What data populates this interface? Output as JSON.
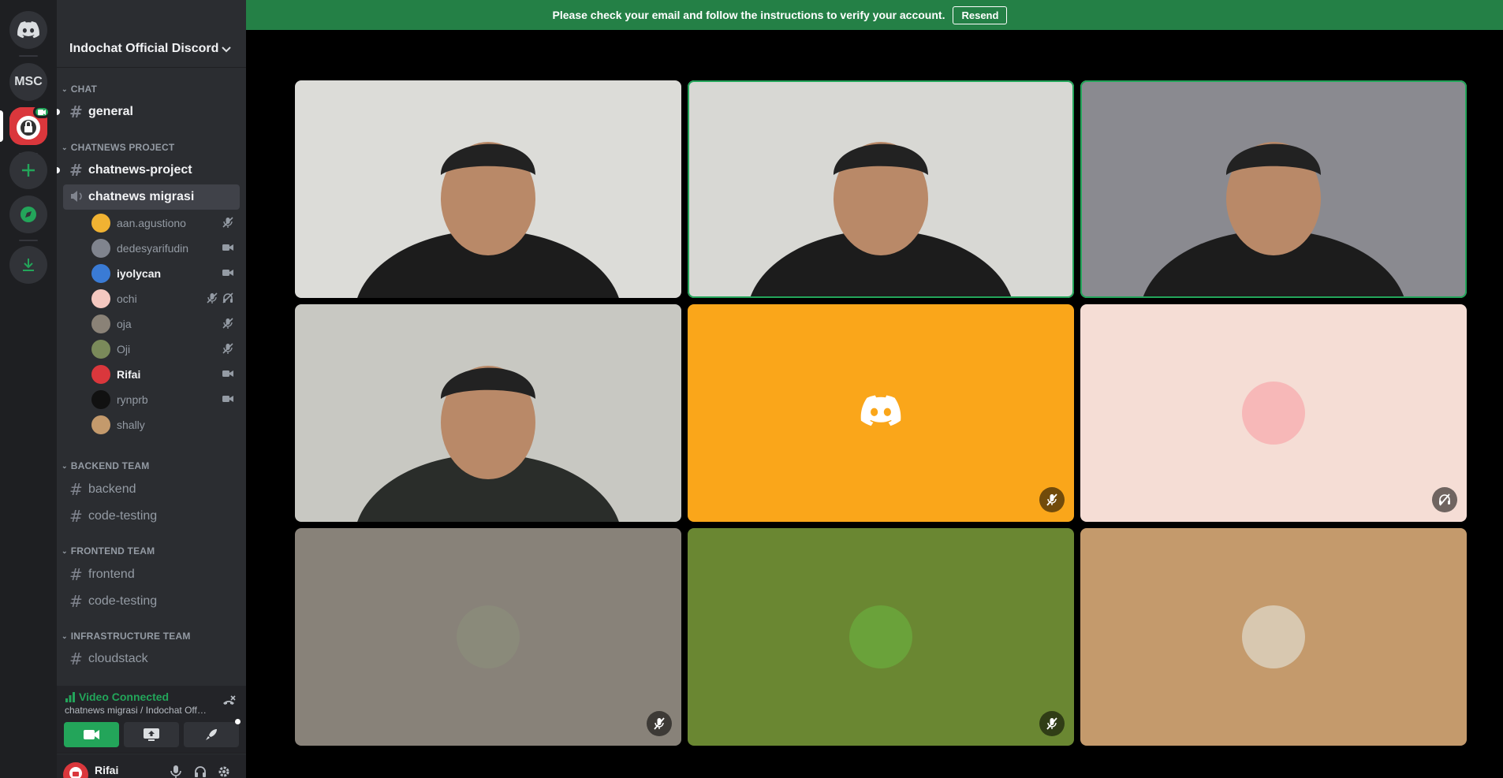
{
  "banner": {
    "message": "Please check your email and follow the instructions to verify your account.",
    "button": "Resend",
    "color": "#248046"
  },
  "rail": {
    "servers": [
      {
        "name": "discord-home-icon"
      },
      {
        "label": "MSC"
      },
      {
        "name": "indochat-server-icon",
        "badge": "video"
      },
      {
        "name": "add-server-icon"
      },
      {
        "name": "explore-icon"
      },
      {
        "name": "download-icon"
      }
    ]
  },
  "server": {
    "name": "Indochat Official Discord"
  },
  "categories": {
    "chat": "CHAT",
    "chatnews_project": "CHATNEWS PROJECT",
    "backend": "BACKEND TEAM",
    "frontend": "FRONTEND TEAM",
    "infrastructure": "INFRASTRUCTURE TEAM"
  },
  "channels": {
    "general": "general",
    "chatnews_project": "chatnews-project",
    "chatnews_migrasi": "chatnews migrasi",
    "backend": "backend",
    "backend_code_testing": "code-testing",
    "frontend": "frontend",
    "frontend_code_testing": "code-testing",
    "cloudstack": "cloudstack"
  },
  "voice_users": [
    {
      "name": "aan.agustiono",
      "icons": [
        "muted-icon"
      ],
      "avatar_color": "#f0b232"
    },
    {
      "name": "dedesyarifudin",
      "icons": [
        "camera-icon"
      ],
      "avatar_color": "#80848e"
    },
    {
      "name": "iyolycan",
      "icons": [
        "camera-icon"
      ],
      "avatar_color": "#3a7bd5",
      "bright": true
    },
    {
      "name": "ochi",
      "icons": [
        "muted-icon",
        "deafened-icon"
      ],
      "avatar_color": "#f4c8c0"
    },
    {
      "name": "oja",
      "icons": [
        "muted-icon"
      ],
      "avatar_color": "#8a8277"
    },
    {
      "name": "Oji",
      "icons": [
        "muted-icon"
      ],
      "avatar_color": "#7a8a5a"
    },
    {
      "name": "Rifai",
      "icons": [
        "camera-icon"
      ],
      "avatar_color": "#da373c",
      "bright": true
    },
    {
      "name": "rynprb",
      "icons": [
        "camera-icon"
      ],
      "avatar_color": "#111111"
    },
    {
      "name": "shally",
      "icons": [],
      "avatar_color": "#c49a6c"
    }
  ],
  "voice_panel": {
    "status": "Video Connected",
    "location": "chatnews migrasi / Indochat Offic..."
  },
  "user_panel": {
    "name": "Rifai"
  },
  "tiles": [
    {
      "name": "video-tile-1",
      "kind": "video",
      "bg": "#dcdcd8"
    },
    {
      "name": "video-tile-2",
      "kind": "video",
      "bg": "#d8d8d4",
      "speaking": true
    },
    {
      "name": "video-tile-3",
      "kind": "video",
      "bg": "#8a8a90",
      "speaking": true
    },
    {
      "name": "video-tile-4",
      "kind": "video",
      "bg": "#c8c8c2"
    },
    {
      "name": "discord-avatar-tile",
      "kind": "discord",
      "bg": "#faa61a",
      "muted": true
    },
    {
      "name": "anime-avatar-tile",
      "kind": "avatar",
      "bg": "#f5ddd5",
      "avatar_color": "#f7b8b8",
      "badge": "deafened"
    },
    {
      "name": "oja-avatar-tile",
      "kind": "avatar",
      "bg": "#888279",
      "avatar_color": "#8a8a7a",
      "muted": true
    },
    {
      "name": "hulk-avatar-tile",
      "kind": "avatar",
      "bg": "#6a8732",
      "avatar_color": "#6aa23a",
      "muted": true
    },
    {
      "name": "shally-avatar-tile",
      "kind": "avatar",
      "bg": "#c49a6c",
      "avatar_color": "#d8c8b0"
    }
  ]
}
